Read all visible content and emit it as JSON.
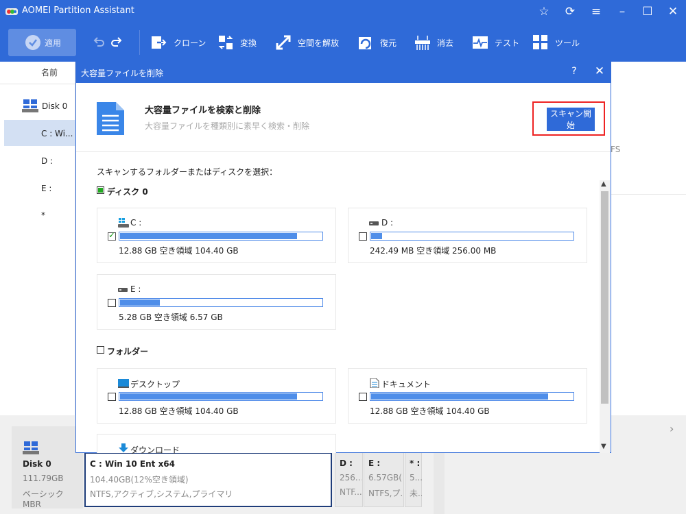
{
  "app": {
    "title": "AOMEI Partition Assistant",
    "window_controls": [
      "star-icon",
      "refresh-icon",
      "menu-icon",
      "minimize-icon",
      "maximize-icon",
      "close-icon"
    ]
  },
  "toolbar": {
    "apply_label": "適用",
    "tools": [
      {
        "label": "クローン",
        "icon": "clone-icon"
      },
      {
        "label": "変換",
        "icon": "convert-icon"
      },
      {
        "label": "空間を解放",
        "icon": "free-space-icon"
      },
      {
        "label": "復元",
        "icon": "recover-icon"
      },
      {
        "label": "消去",
        "icon": "wipe-icon"
      },
      {
        "label": "テスト",
        "icon": "test-icon"
      },
      {
        "label": "ツール",
        "icon": "tools-icon"
      }
    ]
  },
  "main": {
    "column_name": "名前",
    "rows": [
      "Disk 0",
      "C : Wi...",
      "D :",
      "E :",
      "*"
    ],
    "right_partial": "FS"
  },
  "disk_map": {
    "disk_name": "Disk 0",
    "disk_size": "111.79GB",
    "disk_type": "ベーシック MBR",
    "partitions": [
      {
        "name": "C : Win 10 Ent x64",
        "size": "104.40GB(12%空き領域)",
        "fs": "NTFS,アクティブ,システム,プライマリ"
      },
      {
        "name": "D :",
        "size": "256...",
        "fs": "NTF..."
      },
      {
        "name": "E :",
        "size": "6.57GB(...",
        "fs": "NTFS,プ..."
      },
      {
        "name": "* :",
        "size": "5...",
        "fs": "未..."
      }
    ]
  },
  "dialog": {
    "title": "大容量ファイルを削除",
    "header_title": "大容量ファイルを検索と削除",
    "header_subtitle": "大容量ファイルを種類別に素早く検索・削除",
    "scan_button": "スキャン開始",
    "select_label": "スキャンするフォルダーまたはディスクを選択：",
    "disk_group": {
      "label": "ディスク 0",
      "checked": true,
      "items": [
        {
          "name": "C :",
          "info": "12.88 GB 空き領域 104.40 GB",
          "used_fraction": 0.877,
          "checked": true,
          "icon": "system-drive-icon"
        },
        {
          "name": "D :",
          "info": "242.49 MB 空き領域 256.00 MB",
          "used_fraction": 0.053,
          "checked": false,
          "icon": "drive-icon"
        },
        {
          "name": "E :",
          "info": "5.28 GB 空き領域 6.57 GB",
          "used_fraction": 0.196,
          "checked": false,
          "icon": "drive-icon"
        }
      ]
    },
    "folder_group": {
      "label": "フォルダー",
      "checked": false,
      "items": [
        {
          "name": "デスクトップ",
          "info": "12.88 GB 空き領域 104.40 GB",
          "used_fraction": 0.877,
          "checked": false,
          "icon": "desktop-icon"
        },
        {
          "name": "ドキュメント",
          "info": "12.88 GB 空き領域 104.40 GB",
          "used_fraction": 0.877,
          "checked": false,
          "icon": "document-icon"
        },
        {
          "name": "ダウンロード",
          "icon": "download-icon"
        }
      ]
    }
  },
  "colors": {
    "accent": "#2f6ad8",
    "bar_fill": "#4f8ee9",
    "highlight": "#e22222",
    "check": "#22aa22"
  }
}
